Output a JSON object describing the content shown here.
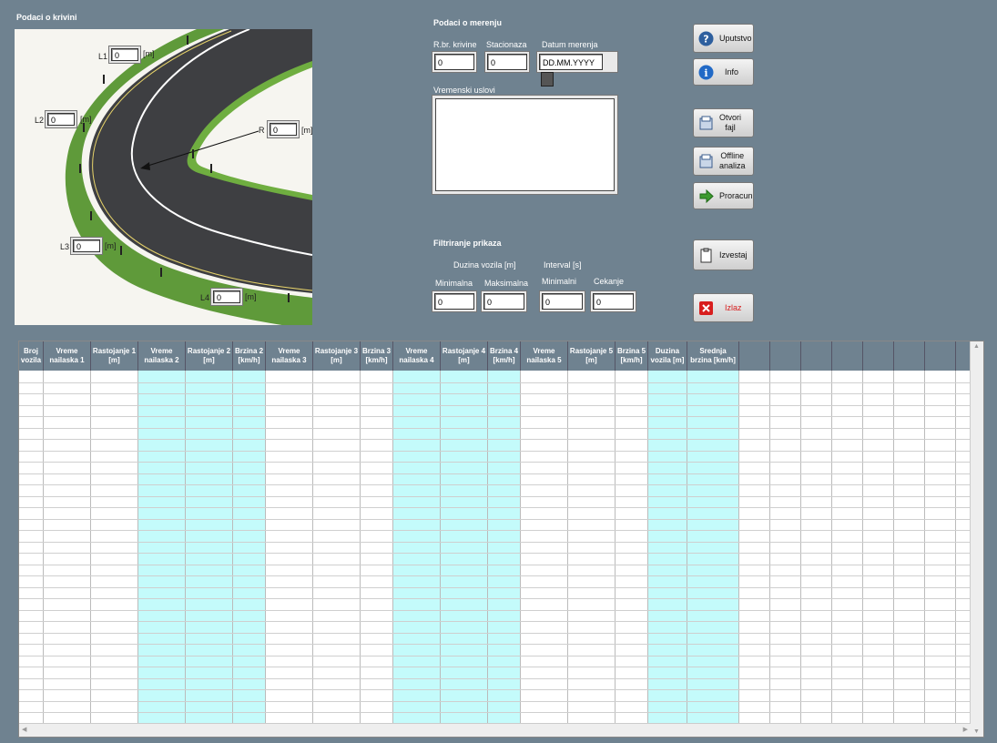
{
  "curve_section": {
    "title": "Podaci o krivini",
    "l1": {
      "label": "L1",
      "value": "0",
      "unit": "[m]"
    },
    "l2": {
      "label": "L2",
      "value": "0",
      "unit": "[m]"
    },
    "l3": {
      "label": "L3",
      "value": "0",
      "unit": "[m]"
    },
    "l4": {
      "label": "L4",
      "value": "0",
      "unit": "[m]"
    },
    "r": {
      "label": "R",
      "value": "0",
      "unit": "[m]"
    }
  },
  "measurement": {
    "title": "Podaci o merenju",
    "curve_no_label": "R.br. krivine",
    "curve_no_value": "0",
    "station_label": "Stacionaza",
    "station_value": "0",
    "date_label": "Datum merenja",
    "date_value": "DD.MM.YYYY",
    "weather_label": "Vremenski uslovi",
    "weather_value": ""
  },
  "filter": {
    "title": "Filtriranje prikaza",
    "length_group": "Duzina vozila [m]",
    "interval_group": "Interval [s]",
    "min_label": "Minimalna",
    "min_value": "0",
    "max_label": "Maksimalna",
    "max_value": "0",
    "imin_label": "Minimalni",
    "imin_value": "0",
    "wait_label": "Cekanje",
    "wait_value": "0"
  },
  "buttons": {
    "uputstvo": "Uputstvo",
    "info": "Info",
    "otvori_1": "Otvori",
    "otvori_2": "fajl",
    "offline_1": "Offline",
    "offline_2": "analiza",
    "proracun": "Proracun",
    "izvestaj": "Izvestaj",
    "izlaz": "Izlaz"
  },
  "colors": {
    "window": "#6f8290",
    "highlight_column": "#c4fbfb",
    "exit_text": "#d81e1e"
  },
  "table": {
    "headers": [
      [
        "Broj",
        "vozila"
      ],
      [
        "Vreme",
        "nailaska 1"
      ],
      [
        "Rastojanje 1",
        "[m]"
      ],
      [
        "Vreme",
        "nailaska 2"
      ],
      [
        "Rastojanje 2",
        "[m]"
      ],
      [
        "Brzina 2",
        "[km/h]"
      ],
      [
        "Vreme",
        "nailaska 3"
      ],
      [
        "Rastojanje 3",
        "[m]"
      ],
      [
        "Brzina 3",
        "[km/h]"
      ],
      [
        "Vreme",
        "nailaska 4"
      ],
      [
        "Rastojanje 4",
        "[m]"
      ],
      [
        "Brzina 4",
        "[km/h]"
      ],
      [
        "Vreme",
        "nailaska 5"
      ],
      [
        "Rastojanje 5",
        "[m]"
      ],
      [
        "Brzina 5",
        "[km/h]"
      ],
      [
        "Duzina",
        "vozila [m]"
      ],
      [
        "Srednja",
        "brzina [km/h]"
      ]
    ]
  }
}
